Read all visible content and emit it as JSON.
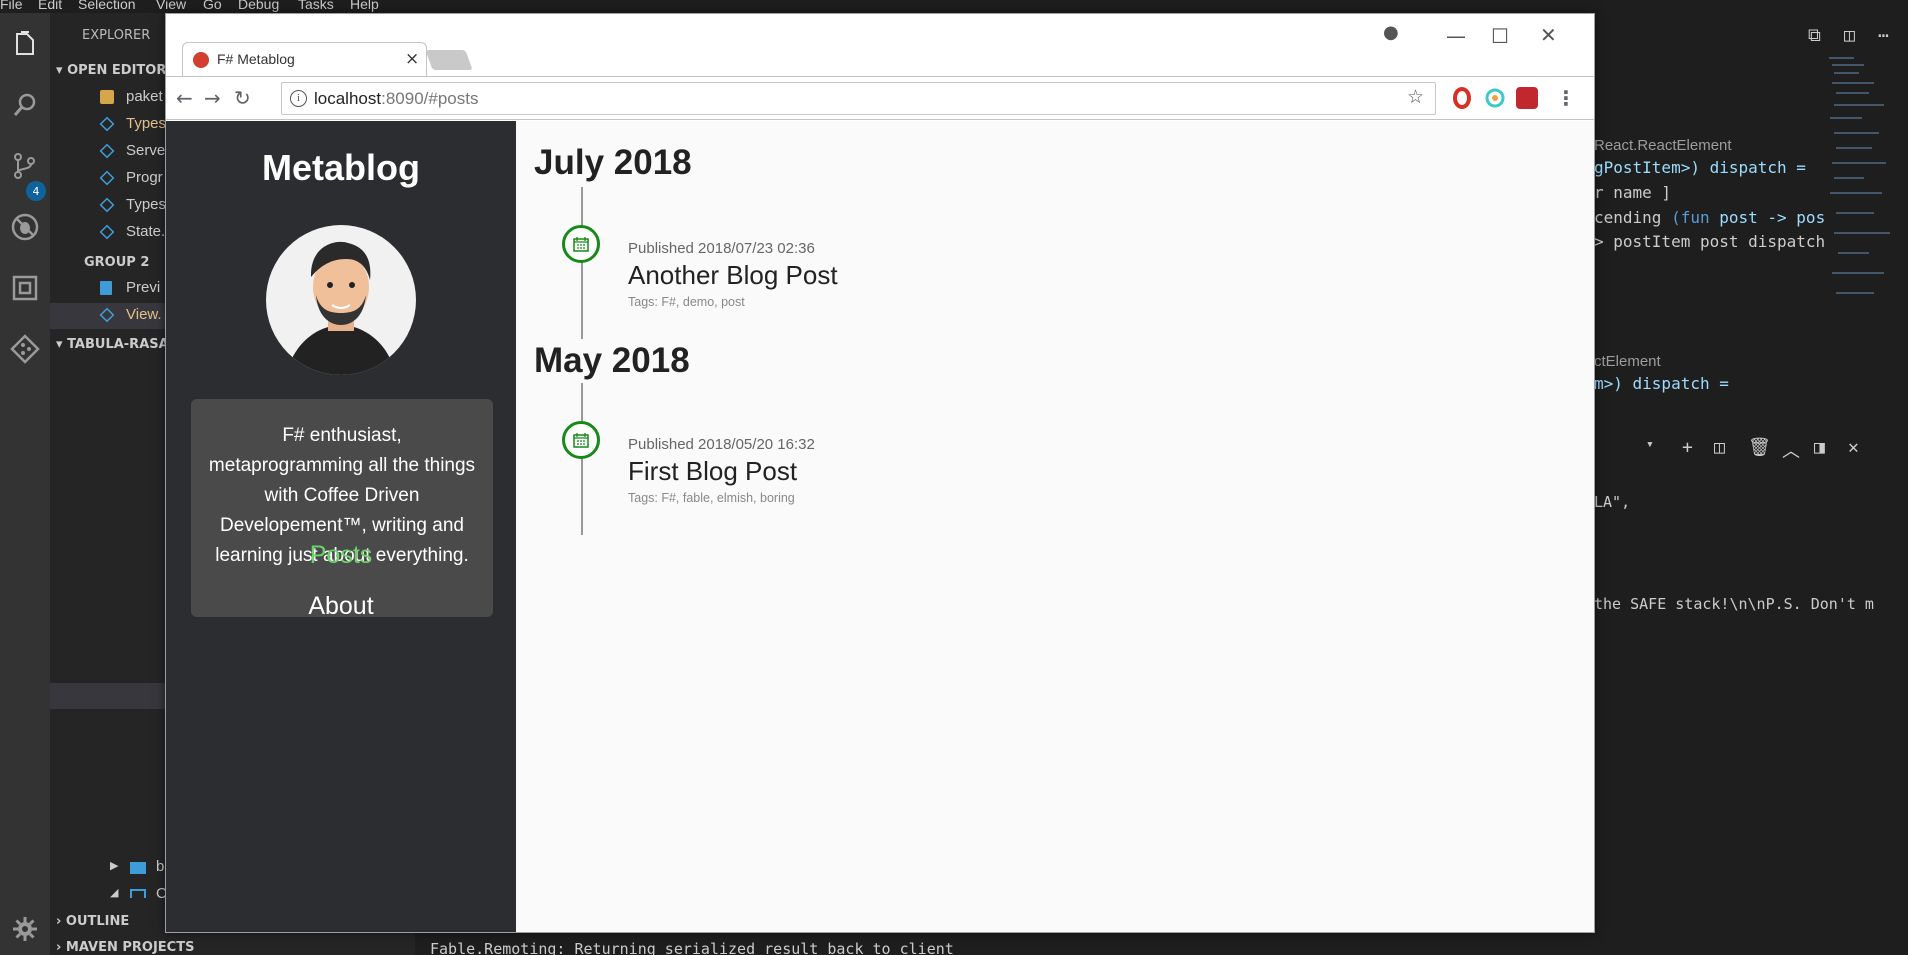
{
  "menubar": [
    "File",
    "Edit",
    "Selection",
    "View",
    "Go",
    "Debug",
    "Tasks",
    "Help"
  ],
  "activity": {
    "badge": "4",
    "icons": [
      "files-icon",
      "search-icon",
      "source-control-icon",
      "debug-icon",
      "extensions-icon",
      "git-icon"
    ]
  },
  "sidebar": {
    "header": "EXPLORER",
    "open_editors": "OPEN EDITORS",
    "group2": "GROUP 2",
    "project": "TABULA-RASA",
    "items": [
      "paket",
      "Types",
      "Serve",
      "Progr",
      "Types",
      "State."
    ],
    "group2_items": [
      "Previ",
      "View."
    ],
    "tree_items": [
      "b",
      "C"
    ],
    "outline": "OUTLINE",
    "maven": "MAVEN PROJECTS"
  },
  "editor": {
    "hint1": "React.ReactElement",
    "line1": "gPostItem>) dispatch =",
    "line2": "r name ]",
    "line3_a": "cending ",
    "line3_kw": "(fun ",
    "line3_b": "post -> pos",
    "line4": "> postItem post dispatch",
    "hint2": "ctElement",
    "line5": "m>) dispatch =",
    "term1": "LA\",",
    "term2": " the SAFE stack!\\n\\nP.S. Don't m",
    "terminal_bottom": "Fable.Remoting: Returning serialized result back to client"
  },
  "browser": {
    "tab_title": "F# Metablog",
    "url_host": "localhost",
    "url_rest": ":8090/#posts"
  },
  "blog": {
    "title": "Metablog",
    "bio": "F# enthusiast, metaprogramming all the things with Coffee Driven Developement™, writing and learning just about everything.",
    "nav": {
      "posts": "Posts",
      "about": "About"
    },
    "nav_active_color": "#6cd36c",
    "months": [
      {
        "label": "July 2018",
        "posts": [
          {
            "published": "Published 2018/07/23 02:36",
            "title": "Another Blog Post",
            "tags": "Tags: F#, demo, post"
          }
        ]
      },
      {
        "label": "May 2018",
        "posts": [
          {
            "published": "Published 2018/05/20 16:32",
            "title": "First Blog Post",
            "tags": "Tags: F#, fable, elmish, boring"
          }
        ]
      }
    ]
  },
  "colors": {
    "accent_green": "#168a16",
    "vscode_blue": "#3e9dd8",
    "dark_panel": "#2b2d31"
  }
}
